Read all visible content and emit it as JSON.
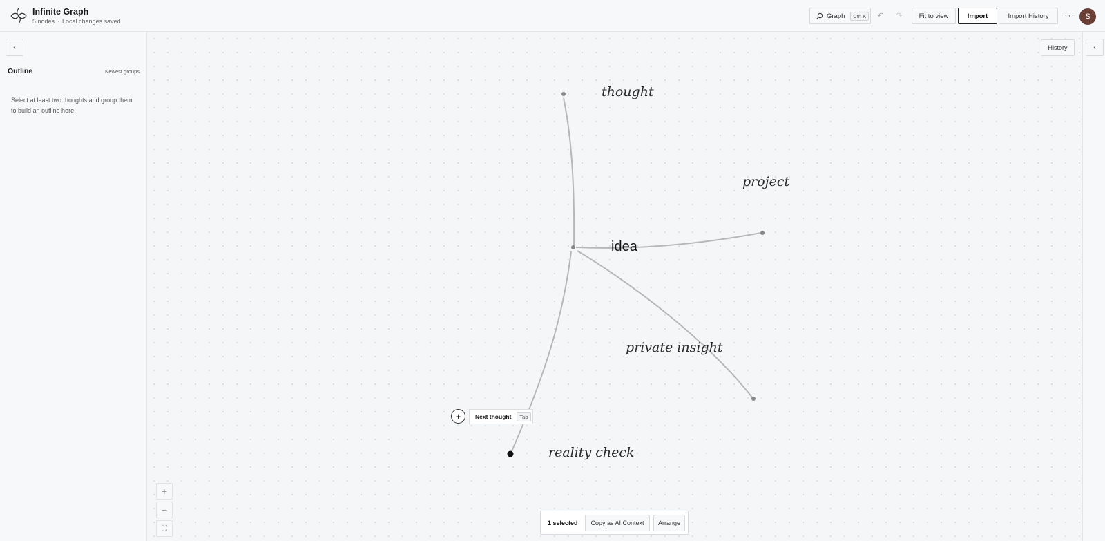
{
  "header": {
    "title": "Infinite Graph",
    "node_count": "5 nodes",
    "save_status": "Local changes saved",
    "search_label": "Graph",
    "search_shortcut": "Ctrl K",
    "fit_to_view": "Fit to view",
    "import": "Import",
    "import_history": "Import History",
    "more": "···",
    "avatar_initial": "S"
  },
  "sidebar": {
    "collapse_glyph": "‹",
    "title": "Outline",
    "sort_label": "Newest groups",
    "empty_message": "Select at least two thoughts and group them to build an outline here."
  },
  "canvas": {
    "history": "History",
    "nodes": {
      "thought": "thought",
      "project": "project",
      "idea": "idea",
      "private_insight": "private insight",
      "reality_check": "reality check"
    },
    "next_thought": {
      "add_glyph": "+",
      "label": "Next thought",
      "shortcut": "Tab"
    }
  },
  "rightbar": {
    "collapse_glyph": "‹"
  },
  "zoom": {
    "in": "+",
    "out": "−",
    "fit": "⛶"
  },
  "selection_bar": {
    "count": "1 selected",
    "copy": "Copy as AI Context",
    "arrange": "Arrange"
  },
  "colors": {
    "edge": "#b5b7ba",
    "node_dot": "#888888",
    "selected_dot": "#111111",
    "avatar": "#6b3f36"
  }
}
